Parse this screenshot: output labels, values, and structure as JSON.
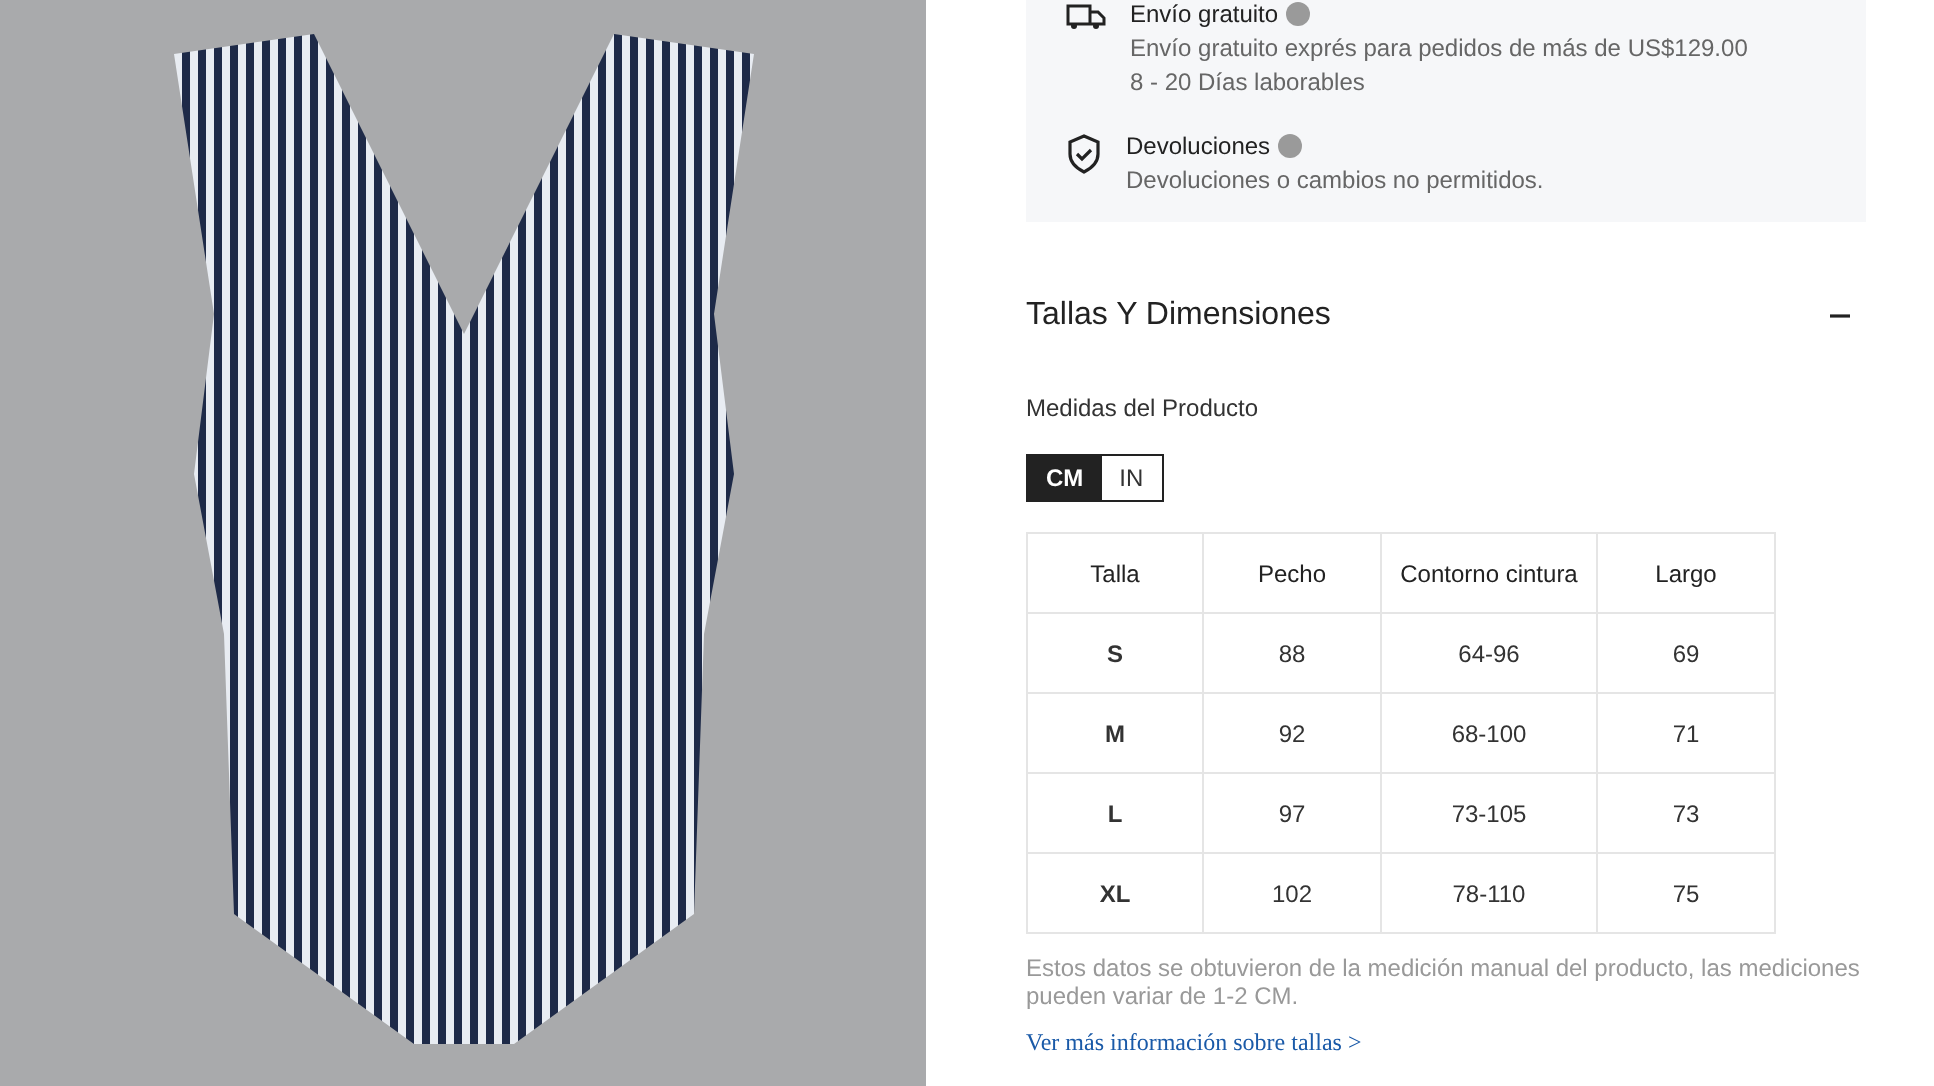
{
  "shipping_info": [
    {
      "kind": "truck",
      "title": "Envío gratuito",
      "lines": [
        "Envío gratuito exprés para pedidos de más de US$129.00",
        "8 - 20 Días laborables"
      ]
    },
    {
      "kind": "shield",
      "title": "Devoluciones",
      "lines": [
        "Devoluciones o cambios no permitidos."
      ]
    }
  ],
  "size_section": {
    "title": "Tallas Y Dimensiones",
    "expanded": true,
    "subtitle": "Medidas del Producto",
    "units": [
      {
        "label": "CM",
        "selected": true
      },
      {
        "label": "IN",
        "selected": false
      }
    ],
    "table": {
      "columns": [
        "Talla",
        "Pecho",
        "Contorno cintura",
        "Largo"
      ],
      "rows": [
        [
          "S",
          "88",
          "64-96",
          "69"
        ],
        [
          "M",
          "92",
          "68-100",
          "71"
        ],
        [
          "L",
          "97",
          "73-105",
          "73"
        ],
        [
          "XL",
          "102",
          "78-110",
          "75"
        ]
      ]
    },
    "note": "Estos datos se obtuvieron de la medición manual del producto, las mediciones pueden variar de 1-2 CM.",
    "link": "Ver más información sobre tallas >"
  }
}
